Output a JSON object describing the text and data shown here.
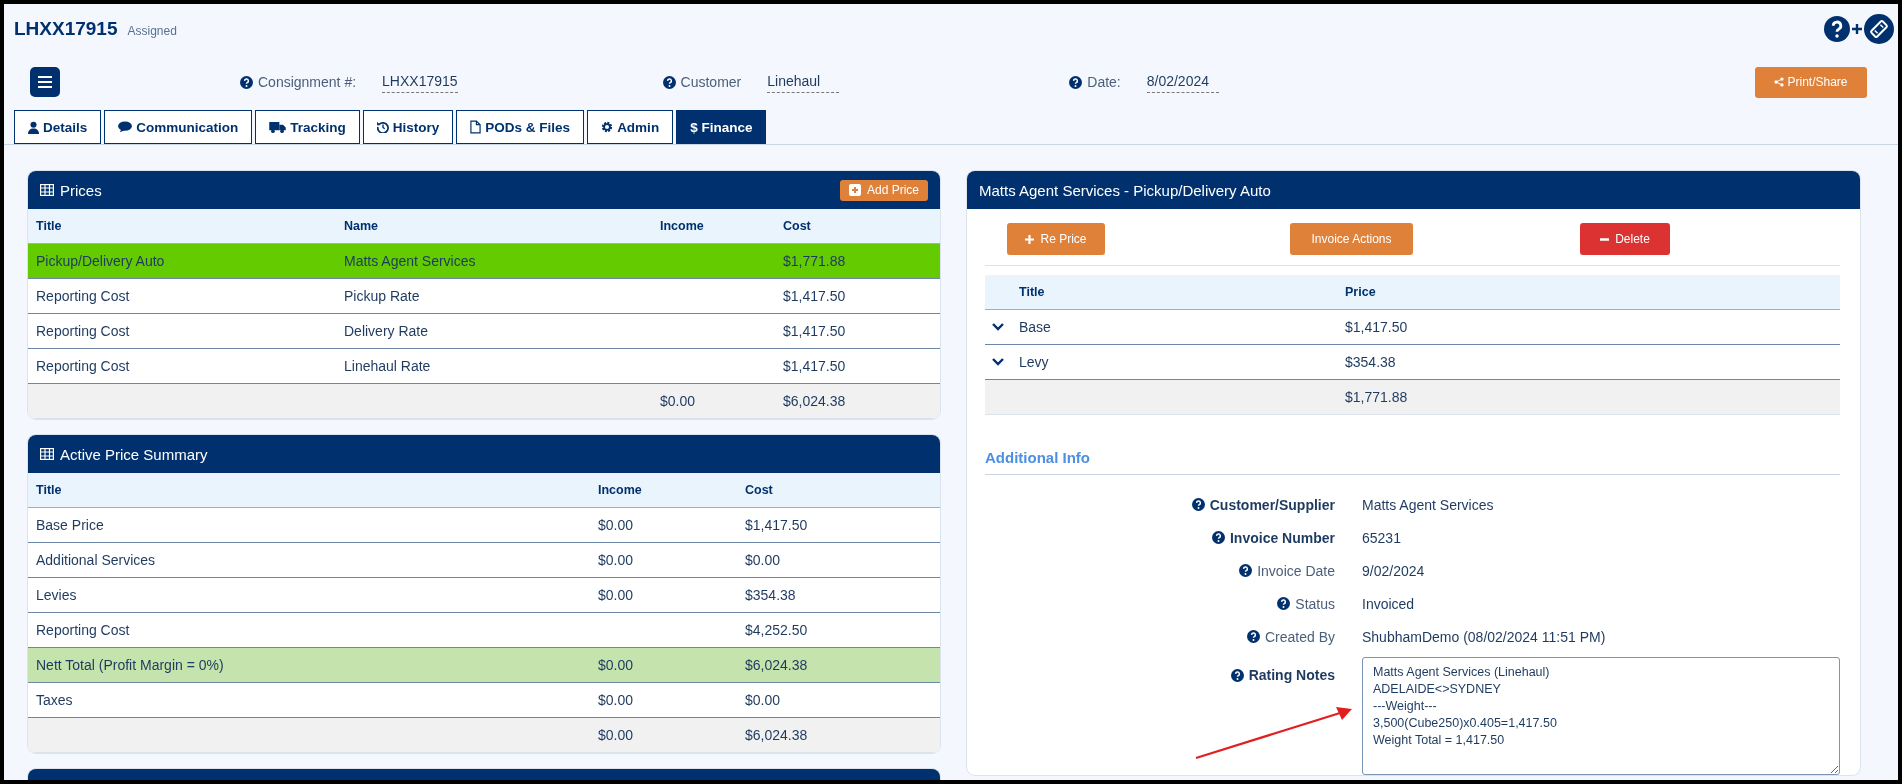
{
  "header": {
    "title": "LHXX17915",
    "status": "Assigned"
  },
  "fields": [
    {
      "label": "Consignment #:",
      "value": "LHXX17915"
    },
    {
      "label": "Customer",
      "value": "Linehaul"
    },
    {
      "label": "Date:",
      "value": "8/02/2024"
    }
  ],
  "print_button": "Print/Share",
  "tabs": [
    {
      "label": "Details",
      "selected": false
    },
    {
      "label": "Communication",
      "selected": false
    },
    {
      "label": "Tracking",
      "selected": false
    },
    {
      "label": "History",
      "selected": false
    },
    {
      "label": "PODs & Files",
      "selected": false
    },
    {
      "label": "Admin",
      "selected": false
    },
    {
      "label": "$ Finance",
      "selected": true
    }
  ],
  "prices": {
    "title": "Prices",
    "add_button": "Add Price",
    "columns": [
      "Title",
      "Name",
      "Income",
      "Cost"
    ],
    "rows": [
      {
        "cells": [
          "Pickup/Delivery Auto",
          "Matts Agent Services",
          "",
          "$1,771.88"
        ],
        "selected": true
      },
      {
        "cells": [
          "Reporting Cost",
          "Pickup Rate",
          "",
          "$1,417.50"
        ],
        "selected": false
      },
      {
        "cells": [
          "Reporting Cost",
          "Delivery Rate",
          "",
          "$1,417.50"
        ],
        "selected": false
      },
      {
        "cells": [
          "Reporting Cost",
          "Linehaul Rate",
          "",
          "$1,417.50"
        ],
        "selected": false
      }
    ],
    "footer": {
      "income": "$0.00",
      "cost": "$6,024.38"
    }
  },
  "summary": {
    "title": "Active Price Summary",
    "columns": [
      "Title",
      "Income",
      "Cost"
    ],
    "rows": [
      {
        "cells": [
          "Base Price",
          "$0.00",
          "$1,417.50"
        ],
        "highlighted": false
      },
      {
        "cells": [
          "Additional Services",
          "$0.00",
          "$0.00"
        ],
        "highlighted": false
      },
      {
        "cells": [
          "Levies",
          "$0.00",
          "$354.38"
        ],
        "highlighted": false
      },
      {
        "cells": [
          "Reporting Cost",
          "",
          "$4,252.50"
        ],
        "highlighted": false
      },
      {
        "cells": [
          "Nett Total (Profit Margin = 0%)",
          "$0.00",
          "$6,024.38"
        ],
        "highlighted": true
      },
      {
        "cells": [
          "Taxes",
          "$0.00",
          "$0.00"
        ],
        "highlighted": false
      }
    ],
    "footer": {
      "income": "$0.00",
      "cost": "$6,024.38"
    }
  },
  "detail": {
    "title": "Matts Agent Services - Pickup/Delivery Auto",
    "buttons": [
      {
        "label": "Re Price",
        "kind": "add"
      },
      {
        "label": "Invoice Actions",
        "kind": "plain"
      },
      {
        "label": "Delete",
        "kind": "danger"
      }
    ],
    "columns": [
      "Title",
      "Price"
    ],
    "rows": [
      {
        "title": "Base",
        "price": "$1,417.50",
        "expanded": false
      },
      {
        "title": "Levy",
        "price": "$354.38",
        "expanded": false
      }
    ],
    "footer": "$1,771.88",
    "section_title": "Additional Info",
    "info": [
      {
        "label": "Customer/Supplier",
        "value": "Matts Agent Services",
        "required": true
      },
      {
        "label": "Invoice Number",
        "value": "65231",
        "required": true
      },
      {
        "label": "Invoice Date",
        "value": "9/02/2024",
        "required": false
      },
      {
        "label": "Status",
        "value": "Invoiced",
        "required": false
      },
      {
        "label": "Created By",
        "value": "ShubhamDemo (08/02/2024 11:51 PM)",
        "required": false
      }
    ],
    "notes": {
      "label": "Rating Notes",
      "value": "Matts Agent Services (Linehaul)\nADELAIDE<>SYDNEY\n---Weight---\n3,500(Cube250)x0.405=1,417.50\nWeight Total = 1,417.50",
      "required": true
    }
  }
}
